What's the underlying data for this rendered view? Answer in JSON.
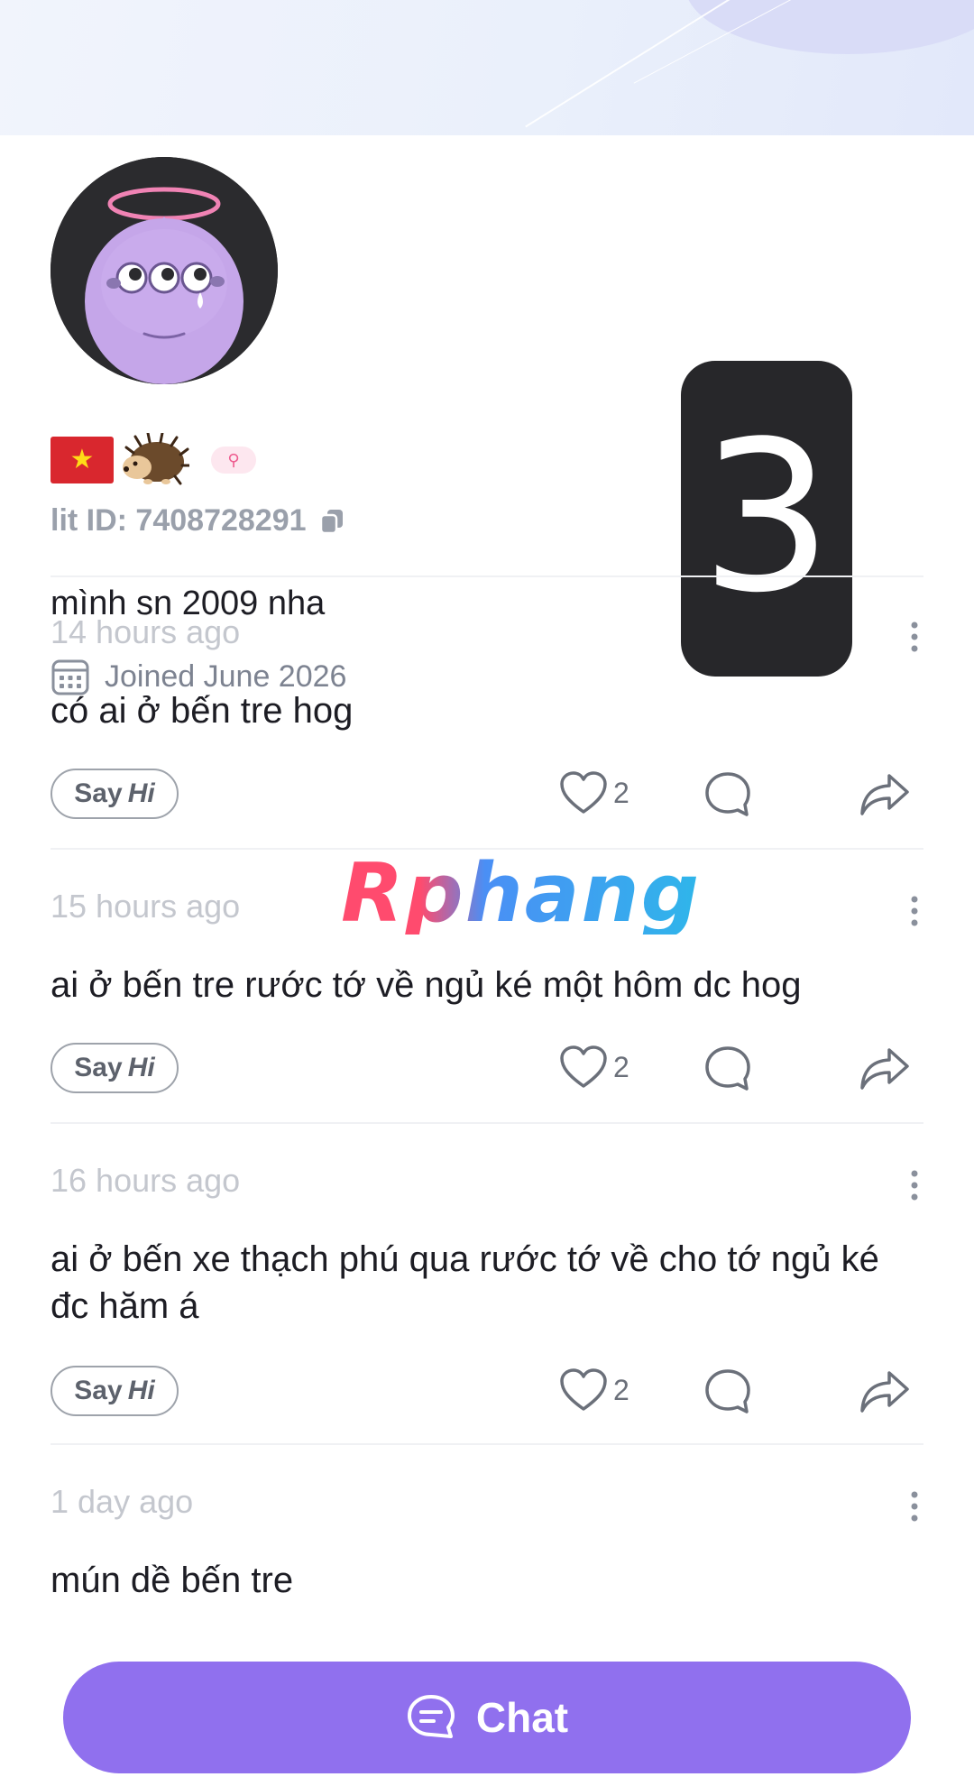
{
  "profile": {
    "lit_id_label": "lit ID: 7408728291",
    "bio": "mình sn 2009 nha",
    "joined": "Joined June 2026",
    "gender_symbol": "⚲",
    "flag_star": "★"
  },
  "counter_overlay": "3",
  "watermark": "Rphang",
  "posts": [
    {
      "time": "14 hours ago",
      "text": "có ai ở bến tre hog",
      "likes": "2"
    },
    {
      "time": "15 hours ago",
      "text": "ai ở bến tre rước tớ về ngủ ké một hôm dc hog",
      "likes": "2"
    },
    {
      "time": "16 hours ago",
      "text": "ai ở bến xe thạch phú qua rước tớ về cho tớ ngủ ké đc hăm á",
      "likes": "2"
    },
    {
      "time": "1 day ago",
      "text": "mún dề bến tre"
    }
  ],
  "say_hi": {
    "say": "Say",
    "hi": "Hi"
  },
  "chat_button": {
    "label": "Chat"
  },
  "colors": {
    "accent": "#9070ee",
    "badge_pink": "#ee5b8e",
    "flag_red": "#d9272e",
    "flag_star": "#ffdc17"
  }
}
